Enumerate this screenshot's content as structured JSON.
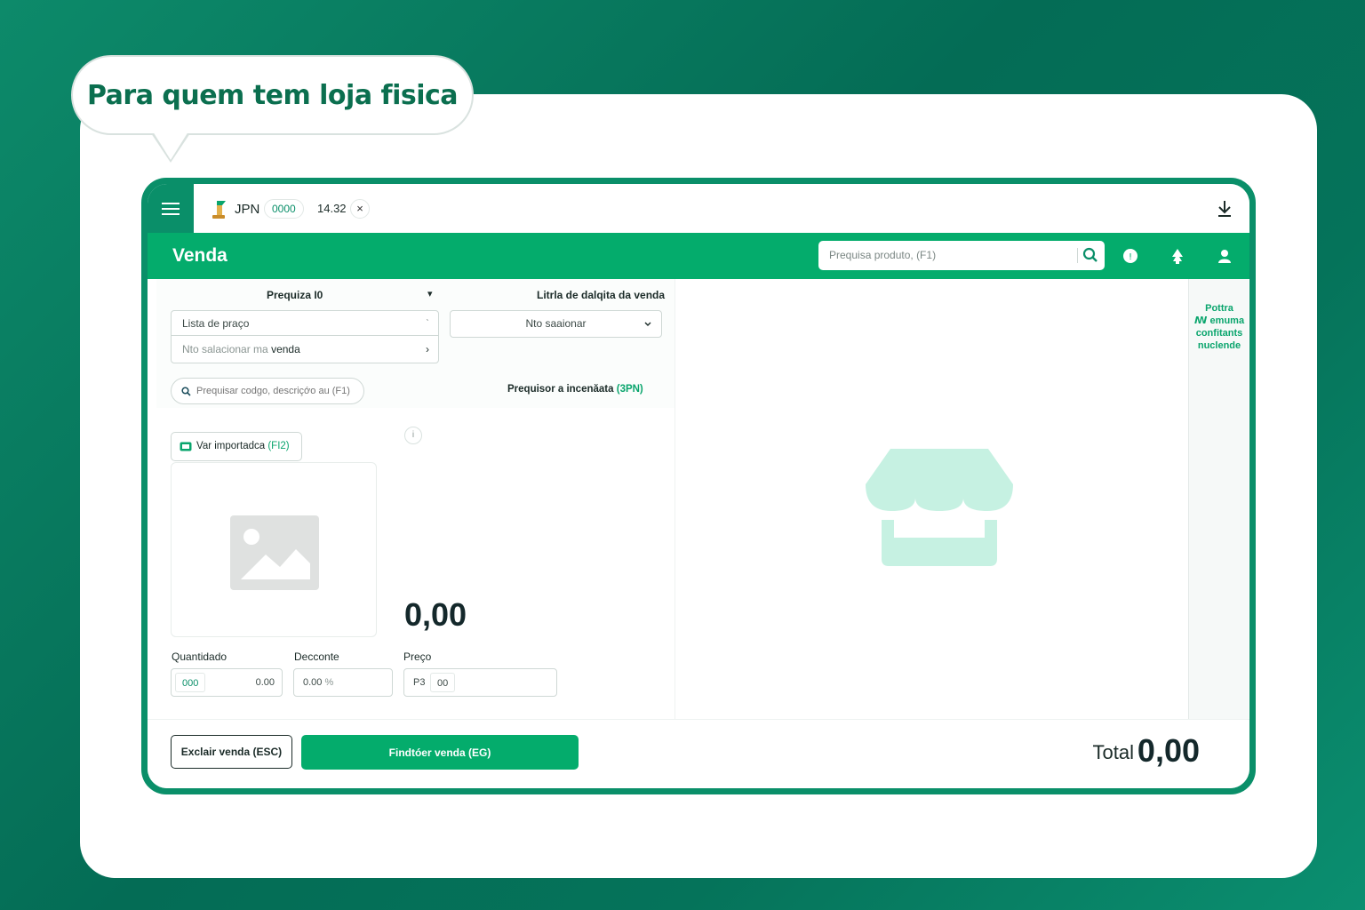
{
  "banner": {
    "text": "Para quem tem loja fisica"
  },
  "tabbar": {
    "tab_name": "JPN",
    "tab_code": "0000",
    "tab_time": "14.32",
    "tab_close": "×"
  },
  "header": {
    "title": "Venda",
    "search_placeholder": "Prequisa produto, (F1)"
  },
  "form": {
    "search_label": "Prequiza I0",
    "search_arrow": "▾",
    "price_list": "Lista de praço",
    "price_list_chevron": "ˋ",
    "sale_select": "Nto salacionar ma",
    "sale_select_b": "venda",
    "sale_select_chevron": "›",
    "sale_type_label": "Litrla de dalqita da venda",
    "sale_type_value": "Nto saaionar",
    "code_search_placeholder": "Prequisar codgo, descriçớo au (F1)",
    "advanced_search": "Prequisor a incenăata",
    "advanced_search_key": "(3PN)",
    "import_button": "Var importadca",
    "import_key": "(FI2)",
    "info_icon_text": "i",
    "price_display": "0,00",
    "qty_label": "Quantidado",
    "qty_unit": "000",
    "qty_value": "0.00",
    "discount_label": "Decconte",
    "discount_value": "0.00",
    "discount_unit": "%",
    "price_label": "Preço",
    "price_prefix": "P3",
    "price_value": "00"
  },
  "right_panel": {
    "text": "Pottra\nꟿ emuma\nconfitants\nnuclende"
  },
  "footer": {
    "cancel_button": "Exclair venda (ESC)",
    "finish_button": "Findtóer venda (EG)",
    "total_label": "Total",
    "total_value": "0,00"
  },
  "colors": {
    "brand": "#04ac6c",
    "dark_green": "#0a8f69",
    "text": "#1b2b28",
    "store_icon": "#c6f1e2"
  },
  "icons": [
    "menu-icon",
    "logo-icon",
    "close-icon",
    "download-icon",
    "search-icon",
    "help-icon",
    "notification-icon",
    "user-icon",
    "image-placeholder-icon",
    "store-icon",
    "info-icon",
    "chevron-down-icon",
    "chevron-right-icon",
    "barcode-icon"
  ]
}
